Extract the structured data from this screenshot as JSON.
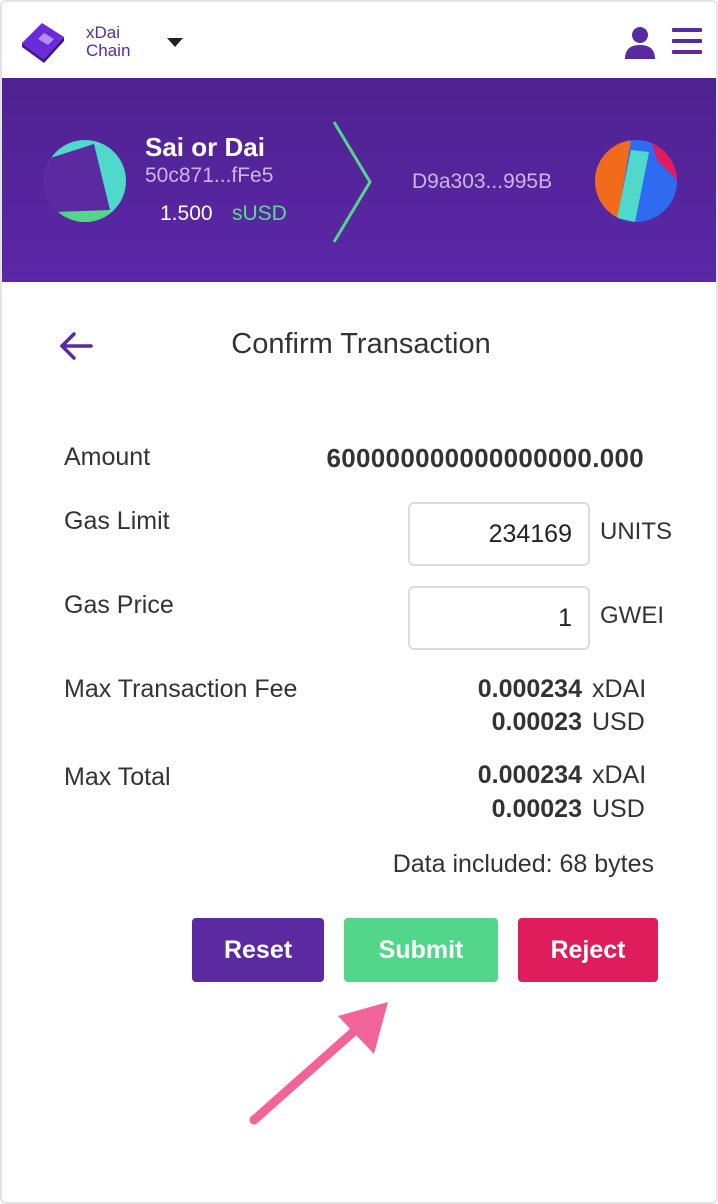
{
  "network": {
    "line1": "xDai",
    "line2": "Chain"
  },
  "sender": {
    "name": "Sai or Dai",
    "address": "50c871...fFe5",
    "balance": "1.500",
    "symbol": "sUSD"
  },
  "recipient": {
    "address": "D9a303...995B"
  },
  "confirm": {
    "title": "Confirm Transaction",
    "amount_label": "Amount",
    "amount_value": "600000000000000000.000",
    "gas_limit_label": "Gas Limit",
    "gas_limit_value": "234169",
    "gas_limit_unit": "UNITS",
    "gas_price_label": "Gas Price",
    "gas_price_value": "1",
    "gas_price_unit": "GWEI",
    "max_fee_label": "Max Transaction Fee",
    "max_fee_native": "0.000234",
    "max_fee_native_unit": "xDAI",
    "max_fee_usd": "0.00023",
    "max_fee_usd_unit": "USD",
    "max_total_label": "Max Total",
    "max_total_native": "0.000234",
    "max_total_native_unit": "xDAI",
    "max_total_usd": "0.00023",
    "max_total_usd_unit": "USD",
    "data_included": "Data included: 68 bytes"
  },
  "buttons": {
    "reset": "Reset",
    "submit": "Submit",
    "reject": "Reject"
  },
  "colors": {
    "brand_purple": "#5b2aa0",
    "submit_green": "#52d68a",
    "reject_red": "#e01d5c",
    "annotation_pink": "#f2639a"
  },
  "icons": {
    "logo": "xdai-logo-icon",
    "user": "user-icon",
    "menu": "hamburger-menu-icon",
    "back": "back-arrow-icon"
  }
}
